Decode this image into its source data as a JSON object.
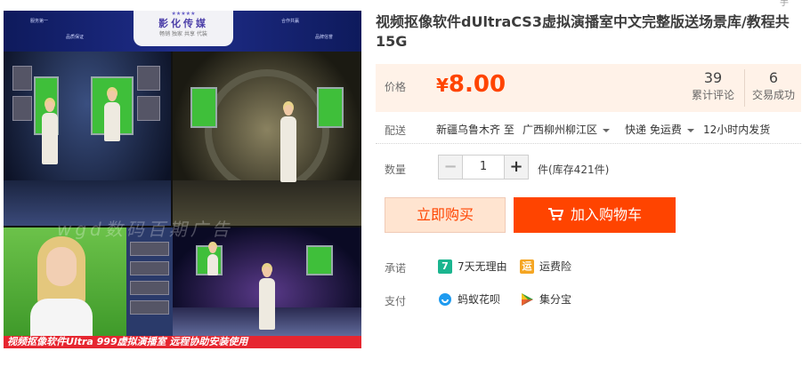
{
  "product": {
    "title": "视频抠像软件dUltraCS3虚拟演播室中文完整版送场景库/教程共15G",
    "image": {
      "brand_name": "影化传媒",
      "brand_slogan": "畅销 独家 共享 代装",
      "banner_left_1": "服务第一",
      "banner_left_2": "品质保证",
      "banner_right_1": "合作共赢",
      "banner_right_2": "品牌信誉",
      "watermark": "wgd数码百期广告",
      "caption": "视频抠像软件Ultra 999虚拟演播室 远程协助安装使用"
    }
  },
  "top_mark": "手",
  "price": {
    "label": "价格",
    "currency": "¥",
    "value": "8.00",
    "accent_color": "#ff4400"
  },
  "stats": [
    {
      "value": "39",
      "label": "累计评论"
    },
    {
      "value": "6",
      "label": "交易成功"
    }
  ],
  "delivery": {
    "label": "配送",
    "from": "新疆乌鲁木齐 至",
    "to": "广西柳州柳江区",
    "method": "快递 免运费",
    "dispatch": "12小时内发货"
  },
  "quantity": {
    "label": "数量",
    "minus": "−",
    "plus": "+",
    "value": "1",
    "stock_text": "件(库存421件)"
  },
  "actions": {
    "buy_now": "立即购买",
    "add_to_cart": "加入购物车"
  },
  "promise": {
    "label": "承诺",
    "items": [
      {
        "badge": "7",
        "text": "7天无理由",
        "color": "#1bb58f",
        "icon": "seven-day-return-icon"
      },
      {
        "badge": "运",
        "text": "运费险",
        "color": "#f5a623",
        "icon": "shipping-insurance-icon"
      }
    ]
  },
  "payment": {
    "label": "支付",
    "items": [
      {
        "text": "蚂蚁花呗",
        "color": "#1e9bf0",
        "icon": "huabei-icon"
      },
      {
        "text": "集分宝",
        "color": "#3a9d3a",
        "icon": "jifenbao-icon"
      }
    ]
  }
}
